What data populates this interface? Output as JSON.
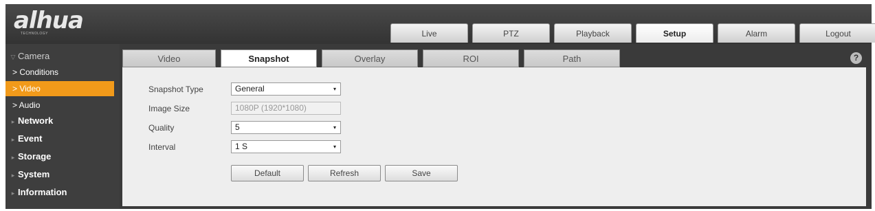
{
  "brand": {
    "logo": "alhua",
    "sub": "TECHNOLOGY"
  },
  "nav": [
    {
      "label": "Live",
      "active": false
    },
    {
      "label": "PTZ",
      "active": false
    },
    {
      "label": "Playback",
      "active": false
    },
    {
      "label": "Setup",
      "active": true
    },
    {
      "label": "Alarm",
      "active": false
    },
    {
      "label": "Logout",
      "active": false
    }
  ],
  "sidebar": {
    "camera": "Camera",
    "sub": [
      "> Conditions",
      "> Video",
      "> Audio"
    ],
    "active_sub": "> Video",
    "items": [
      "Network",
      "Event",
      "Storage",
      "System",
      "Information"
    ]
  },
  "tabs": [
    "Video",
    "Snapshot",
    "Overlay",
    "ROI",
    "Path"
  ],
  "active_tab": "Snapshot",
  "form": {
    "snapshot_type": {
      "label": "Snapshot Type",
      "value": "General"
    },
    "image_size": {
      "label": "Image Size",
      "value": "1080P (1920*1080)"
    },
    "quality": {
      "label": "Quality",
      "value": "5"
    },
    "interval": {
      "label": "Interval",
      "value": "1 S"
    }
  },
  "buttons": {
    "default": "Default",
    "refresh": "Refresh",
    "save": "Save"
  },
  "help": "?",
  "icons": {
    "dropdown": "▾",
    "collapse": "▽",
    "bullet": "▸"
  },
  "colors": {
    "accent": "#f29a1a",
    "header": "#3a3a3a",
    "panel": "#eeeeee"
  }
}
